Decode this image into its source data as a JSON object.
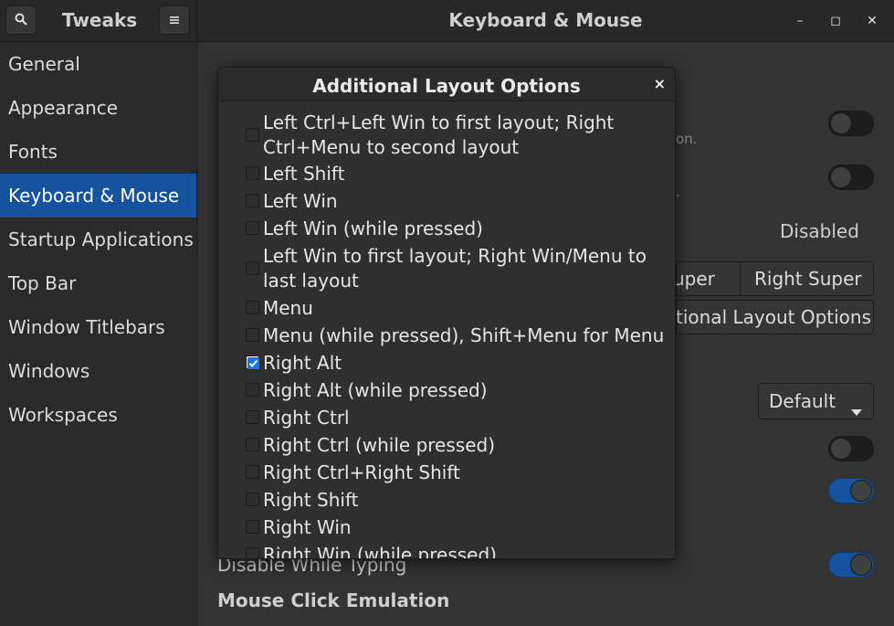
{
  "header": {
    "app_title": "Tweaks",
    "page_title": "Keyboard & Mouse",
    "search_icon": "search-icon",
    "menu_icon": "hamburger-menu-icon",
    "minimize_icon": "minimize-icon",
    "maximize_icon": "maximize-icon",
    "close_icon": "close-icon",
    "minimize_glyph": "–",
    "maximize_glyph": "◻",
    "close_glyph": "✕"
  },
  "sidebar": {
    "items": [
      {
        "label": "General"
      },
      {
        "label": "Appearance"
      },
      {
        "label": "Fonts"
      },
      {
        "label": "Keyboard & Mouse",
        "active": true
      },
      {
        "label": "Startup Applications"
      },
      {
        "label": "Top Bar"
      },
      {
        "label": "Window Titlebars"
      },
      {
        "label": "Windows"
      },
      {
        "label": "Workspaces"
      }
    ]
  },
  "background": {
    "hint1": "on.",
    "hint2": ".",
    "disabled_value": "Disabled",
    "super_left_partial": "uper",
    "right_super": "Right Super",
    "additional_layout_partial": "tional Layout Options",
    "default_select": "Default",
    "disable_while_typing": "Disable While Typing",
    "mouse_click_emulation": "Mouse Click Emulation",
    "switch_states": {
      "s1": false,
      "s2": false,
      "s3": false,
      "s4": true,
      "s5": true
    }
  },
  "dialog": {
    "title": "Additional Layout Options",
    "close_glyph": "×",
    "options": [
      {
        "label": "Left Ctrl+Left Win to first layout; Right Ctrl+Menu to second layout",
        "checked": false
      },
      {
        "label": "Left Shift",
        "checked": false
      },
      {
        "label": "Left Win",
        "checked": false
      },
      {
        "label": "Left Win (while pressed)",
        "checked": false
      },
      {
        "label": "Left Win to first layout; Right Win/Menu to last layout",
        "checked": false
      },
      {
        "label": "Menu",
        "checked": false
      },
      {
        "label": "Menu (while pressed), Shift+Menu for Menu",
        "checked": false
      },
      {
        "label": "Right Alt",
        "checked": true
      },
      {
        "label": "Right Alt (while pressed)",
        "checked": false
      },
      {
        "label": "Right Ctrl",
        "checked": false
      },
      {
        "label": "Right Ctrl (while pressed)",
        "checked": false
      },
      {
        "label": "Right Ctrl+Right Shift",
        "checked": false
      },
      {
        "label": "Right Shift",
        "checked": false
      },
      {
        "label": "Right Win",
        "checked": false
      },
      {
        "label": "Right Win (while pressed)",
        "checked": false
      }
    ]
  },
  "colors": {
    "accent": "#15539e",
    "check_blue": "#1a73e8"
  }
}
